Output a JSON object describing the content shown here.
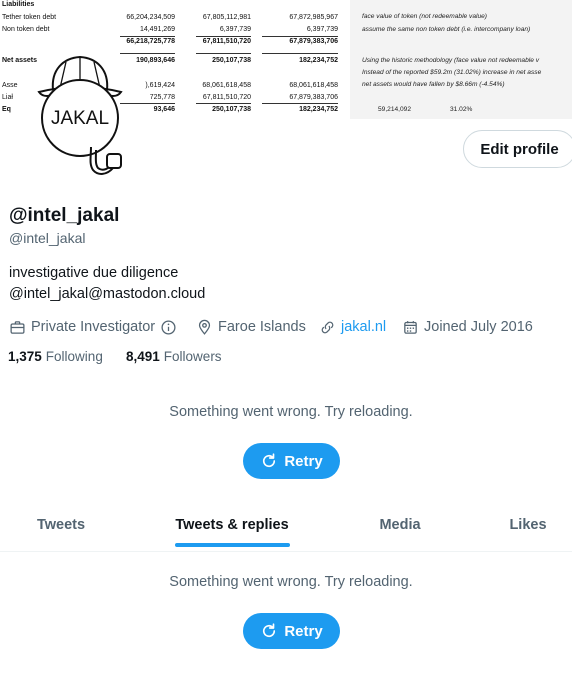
{
  "banner": {
    "rows": [
      {
        "label": "Liabilities",
        "c1": "",
        "c2": "",
        "c3": "",
        "bold": true
      },
      {
        "label": "Tether token debt",
        "c1": "66,204,234,509",
        "c2": "67,805,112,981",
        "c3": "67,872,985,967"
      },
      {
        "label": "Non token debt",
        "c1": "14,491,269",
        "c2": "6,397,739",
        "c3": "6,397,739"
      },
      {
        "label": "",
        "c1": "66,218,725,778",
        "c2": "67,811,510,720",
        "c3": "67,879,383,706",
        "bold": true
      },
      {
        "label": "Net assets",
        "c1": "190,893,646",
        "c2": "250,107,738",
        "c3": "182,234,752",
        "bold": true
      },
      {
        "label": "Asse",
        "c1": "),619,424",
        "c2": "68,061,618,458",
        "c3": "68,061,618,458"
      },
      {
        "label": "Liał",
        "c1": "725,778",
        "c2": "67,811,510,720",
        "c3": "67,879,383,706"
      },
      {
        "label": "Eq",
        "c1": "93,646",
        "c2": "250,107,738",
        "c3": "182,234,752",
        "bold": true
      }
    ],
    "notes": [
      "face value of token (not redeemable value)",
      "assume the same non token debt (i.e. intercompany loan)",
      "Using the historic methodology (face value not redeemable v",
      "Instead of the reported $59.2m (31.02%) increase in net asse",
      "net assets would have fallen by $8.66m (-4.54%)"
    ],
    "note_fig1": "59,214,092",
    "note_fig2": "31.02%"
  },
  "avatar": {
    "text": "JAKAL"
  },
  "edit_profile_label": "Edit profile",
  "profile": {
    "name": "@intel_jakal",
    "handle": "@intel_jakal",
    "bio_line1": "investigative due diligence",
    "bio_line2": "@intel_jakal@mastodon.cloud",
    "category": "Private Investigator",
    "location": "Faroe Islands",
    "website": "jakal.nl",
    "joined": "Joined July 2016",
    "following_count": "1,375",
    "following_label": "Following",
    "followers_count": "8,491",
    "followers_label": "Followers"
  },
  "error_message": "Something went wrong. Try reloading.",
  "retry_label": "Retry",
  "tabs": [
    {
      "label": "Tweets"
    },
    {
      "label": "Tweets & replies"
    },
    {
      "label": "Media"
    },
    {
      "label": "Likes"
    }
  ],
  "colors": {
    "accent": "#1d9bf0",
    "muted": "#536471",
    "text": "#0f1419"
  }
}
